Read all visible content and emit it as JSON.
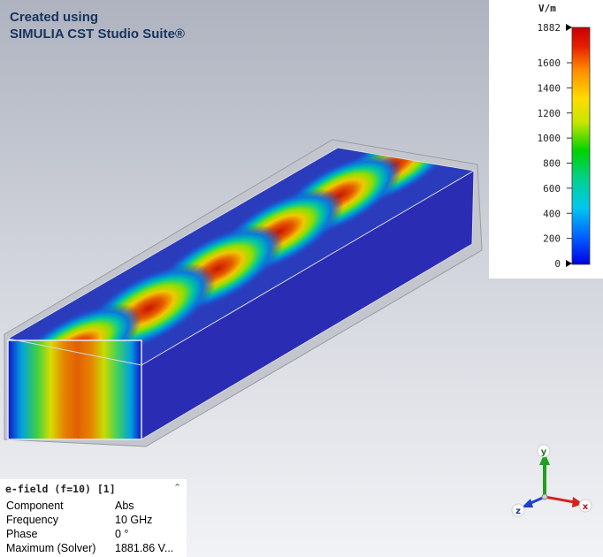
{
  "watermark": {
    "line1": "Created using",
    "line2": "SIMULIA CST Studio Suite®"
  },
  "legend": {
    "unit": "V/m",
    "ticks": [
      "1882",
      "1600",
      "1400",
      "1200",
      "1000",
      "800",
      "600",
      "400",
      "200",
      "0"
    ],
    "max_value": 1882,
    "min_value": 0,
    "colors": [
      "#0000e6",
      "#00a0ff",
      "#00e0e0",
      "#00d200",
      "#c8e600",
      "#ffdc00",
      "#ff8c00",
      "#e61e00",
      "#c80000"
    ]
  },
  "info": {
    "title": "e-field (f=10) [1]",
    "rows": [
      {
        "key": "Component",
        "value": "Abs"
      },
      {
        "key": "Frequency",
        "value": "10 GHz"
      },
      {
        "key": "Phase",
        "value": "0 °"
      },
      {
        "key": "Maximum (Solver)",
        "value": "1881.86 V..."
      }
    ]
  },
  "axes": {
    "x": "x",
    "y": "y",
    "z": "z",
    "colors": {
      "x": "#d62020",
      "y": "#1fa01f",
      "z": "#2040d0"
    }
  }
}
